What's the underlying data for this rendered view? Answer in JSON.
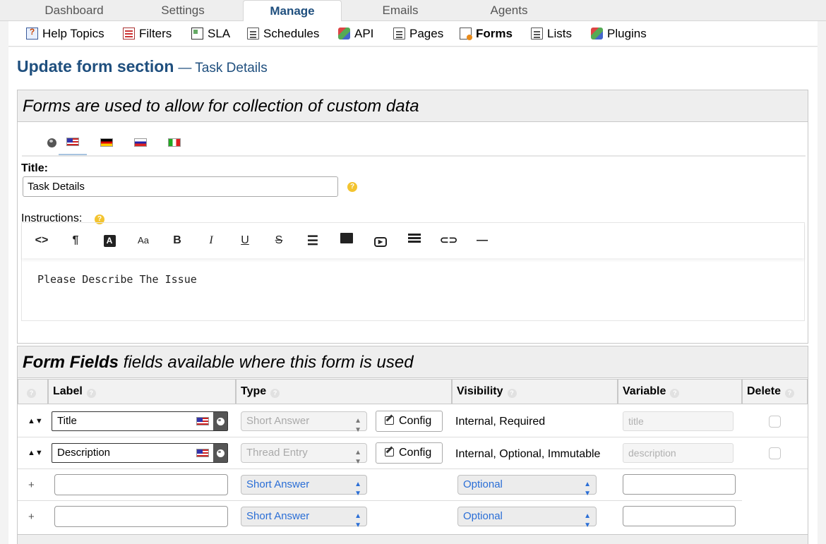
{
  "top_tabs": [
    "Dashboard",
    "Settings",
    "Manage",
    "Emails",
    "Agents"
  ],
  "sub_nav": [
    {
      "label": "Help Topics",
      "icon": "help-topics-icon"
    },
    {
      "label": "Filters",
      "icon": "filters-icon"
    },
    {
      "label": "SLA",
      "icon": "sla-icon"
    },
    {
      "label": "Schedules",
      "icon": "schedules-icon"
    },
    {
      "label": "API",
      "icon": "api-icon"
    },
    {
      "label": "Pages",
      "icon": "pages-icon"
    },
    {
      "label": "Forms",
      "icon": "forms-icon"
    },
    {
      "label": "Lists",
      "icon": "lists-icon"
    },
    {
      "label": "Plugins",
      "icon": "plugins-icon"
    }
  ],
  "page": {
    "title": "Update form section",
    "subtitle": "— Task Details"
  },
  "form_section": {
    "header": "Forms are used to allow for collection of custom data",
    "title_label": "Title:",
    "title_value": "Task Details",
    "instructions_label": "Instructions:",
    "instructions_text": "Please Describe The Issue"
  },
  "fields_section": {
    "header_bold": "Form Fields",
    "header_rest": " fields available where this form is used",
    "columns": {
      "label": "Label",
      "type": "Type",
      "visibility": "Visibility",
      "variable": "Variable",
      "delete": "Delete"
    },
    "rows": [
      {
        "label": "Title",
        "type": "Short Answer",
        "config": "Config",
        "visibility": "Internal, Required",
        "variable": "title"
      },
      {
        "label": "Description",
        "type": "Thread Entry",
        "config": "Config",
        "visibility": "Internal, Optional, Immutable",
        "variable": "description"
      }
    ],
    "new_rows": [
      {
        "type": "Short Answer",
        "visibility": "Optional"
      },
      {
        "type": "Short Answer",
        "visibility": "Optional"
      }
    ],
    "plus": "+",
    "sort_glyph": "▲▼"
  }
}
